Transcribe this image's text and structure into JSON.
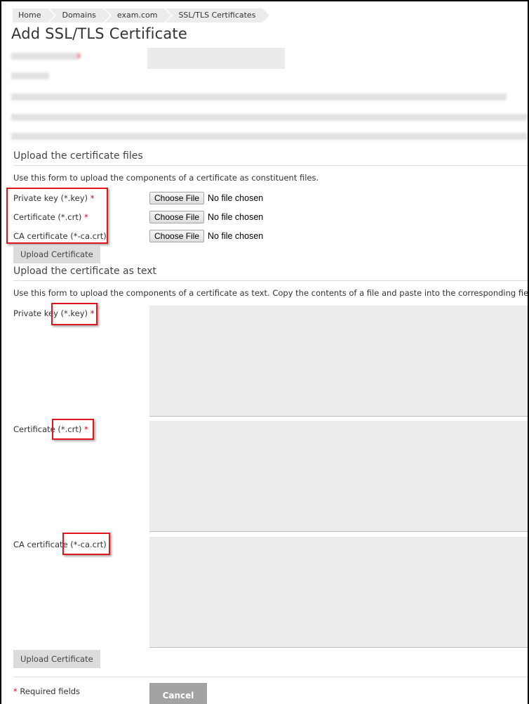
{
  "breadcrumb": [
    {
      "label": "Home"
    },
    {
      "label": "Domains"
    },
    {
      "label": "exam.com"
    },
    {
      "label": "SSL/TLS Certificates"
    }
  ],
  "page_title": "Add SSL/TLS Certificate",
  "file_section": {
    "title": "Upload the certificate files",
    "description": "Use this form to upload the components of a certificate as constituent files.",
    "fields": [
      {
        "label": "Private key (*.key)",
        "required": true,
        "button": "Choose File",
        "status": "No file chosen"
      },
      {
        "label": "Certificate (*.crt)",
        "required": true,
        "button": "Choose File",
        "status": "No file chosen"
      },
      {
        "label": "CA certificate (*-ca.crt)",
        "required": false,
        "button": "Choose File",
        "status": "No file chosen"
      }
    ],
    "submit_label": "Upload Certificate"
  },
  "text_section": {
    "title": "Upload the certificate as text",
    "description": "Use this form to upload the components of a certificate as text. Copy the contents of a file and paste into the corresponding field.",
    "fields": [
      {
        "label": "Private key (*.key)",
        "required": true,
        "value": ""
      },
      {
        "label": "Certificate (*.crt)",
        "required": true,
        "value": ""
      },
      {
        "label": "CA certificate (*-ca.crt)",
        "required": false,
        "value": ""
      }
    ],
    "submit_label": "Upload Certificate"
  },
  "required_mark": "*",
  "required_note": "Required fields",
  "cancel_label": "Cancel",
  "colors": {
    "required": "#d0021b",
    "highlight": "#e0161d"
  }
}
